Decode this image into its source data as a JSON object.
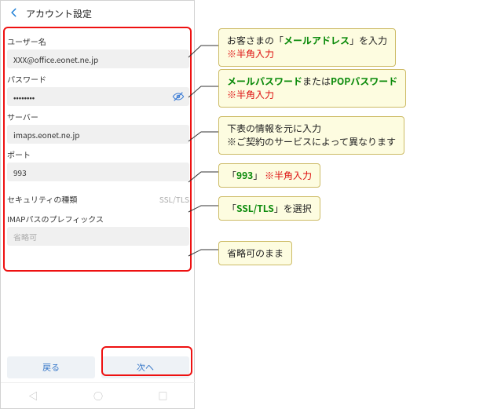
{
  "topbar": {
    "title": "アカウント設定"
  },
  "labels": {
    "username": "ユーザー名",
    "password": "パスワード",
    "server": "サーバー",
    "port": "ポート",
    "security": "セキュリティの種類",
    "imap_prefix": "IMAPパスのプレフィックス"
  },
  "values": {
    "username": "XXX@office.eonet.ne.jp",
    "password": "••••••••",
    "server": "imaps.eonet.ne.jp",
    "port": "993",
    "security": "SSL/TLS",
    "imap_prefix_placeholder": "省略可"
  },
  "buttons": {
    "back": "戻る",
    "next": "次へ"
  },
  "callouts": {
    "c1a": "お客さまの「",
    "c1b": "メールアドレス",
    "c1c": "」を入力",
    "c1d": "※半角入力",
    "c2a": "メールパスワード",
    "c2b": "または",
    "c2c": "POPパスワード",
    "c2d": "※半角入力",
    "c3a": "下表の情報を元に入力",
    "c3b": "※ご契約のサービスによって異なります",
    "c4a": "「",
    "c4b": "993",
    "c4c": "」",
    "c4d": "※半角入力",
    "c5a": "「",
    "c5b": "SSL/TLS",
    "c5c": "」を選択",
    "c6": "省略可のまま"
  }
}
